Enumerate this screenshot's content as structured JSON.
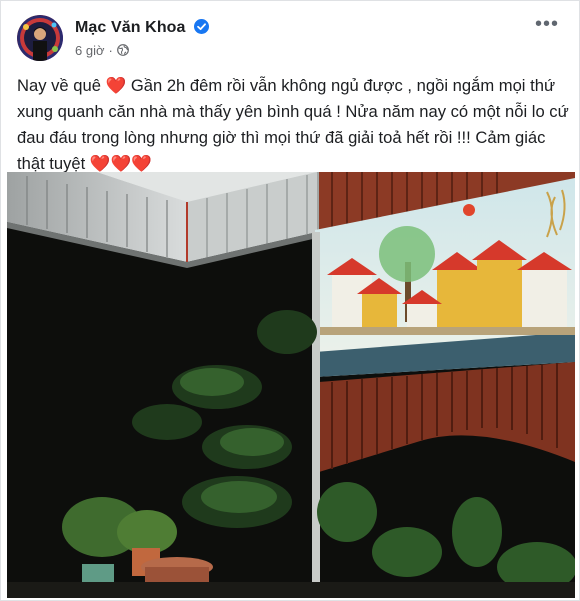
{
  "post": {
    "author": "Mạc Văn Khoa",
    "time": "6 giờ",
    "dot": "·",
    "more_label": "•••",
    "caption_part1": "Nay về quê ",
    "heart_a": "❤️",
    "caption_part2": " Gần 2h đêm rồi vẫn không ngủ được , ngồi ngắm mọi thứ xung quanh căn nhà mà thấy yên bình quá ! Nửa năm nay có một nỗi lo cứ đau đáu trong lòng nhưng giờ thì mọi thứ đã giải toả hết rồi !!! Cảm giác thật tuyệt ",
    "heart_b": "❤️❤️❤️"
  },
  "icons": {
    "verified": "verified-badge-icon",
    "audience": "globe-icon",
    "more": "more-options-icon"
  },
  "colors": {
    "verified": "#1877f2",
    "heart": "#e02b2b",
    "meta": "#65676b"
  }
}
